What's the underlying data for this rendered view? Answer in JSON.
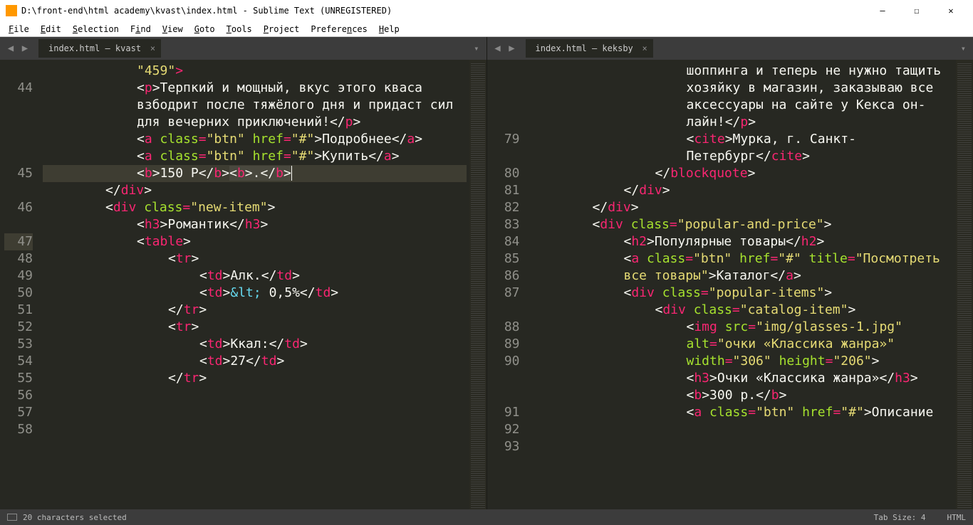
{
  "titlebar": {
    "path": "D:\\front-end\\html academy\\kvast\\index.html - Sublime Text (UNREGISTERED)"
  },
  "menu": [
    "File",
    "Edit",
    "Selection",
    "Find",
    "View",
    "Goto",
    "Tools",
    "Project",
    "Preferences",
    "Help"
  ],
  "tabs": {
    "left": "index.html — kvast",
    "right": "index.html — keksby"
  },
  "left": {
    "gutter": [
      "",
      "44",
      "",
      "",
      "",
      "",
      "45",
      "",
      "46",
      "",
      "47",
      "48",
      "49",
      "50",
      "51",
      "52",
      "53",
      "54",
      "55",
      "56",
      "57",
      "58",
      ""
    ],
    "lines": [
      {
        "indent": 3,
        "tokens": [
          {
            "c": "s",
            "t": "\"459\""
          },
          {
            "c": "t",
            "t": ">"
          }
        ]
      },
      {
        "indent": 3,
        "tokens": [
          {
            "c": "p",
            "t": "<"
          },
          {
            "c": "t",
            "t": "p"
          },
          {
            "c": "p",
            "t": ">"
          },
          {
            "c": "w",
            "t": "Терпкий и мощный, вкус этого кваса взбодрит после тяжёлого дня и придаст сил для вечерних приключений!"
          },
          {
            "c": "p",
            "t": "</"
          },
          {
            "c": "t",
            "t": "p"
          },
          {
            "c": "p",
            "t": ">"
          }
        ]
      },
      {
        "indent": 3,
        "tokens": [
          {
            "c": "p",
            "t": "<"
          },
          {
            "c": "t",
            "t": "a"
          },
          {
            "c": "w",
            "t": " "
          },
          {
            "c": "a",
            "t": "class"
          },
          {
            "c": "t",
            "t": "="
          },
          {
            "c": "s",
            "t": "\"btn\""
          },
          {
            "c": "w",
            "t": " "
          },
          {
            "c": "a",
            "t": "href"
          },
          {
            "c": "t",
            "t": "="
          },
          {
            "c": "s",
            "t": "\"#\""
          },
          {
            "c": "p",
            "t": ">"
          },
          {
            "c": "w",
            "t": "Подробнее"
          },
          {
            "c": "p",
            "t": "</"
          },
          {
            "c": "t",
            "t": "a"
          },
          {
            "c": "p",
            "t": ">"
          }
        ]
      },
      {
        "indent": 3,
        "tokens": [
          {
            "c": "p",
            "t": "<"
          },
          {
            "c": "t",
            "t": "a"
          },
          {
            "c": "w",
            "t": " "
          },
          {
            "c": "a",
            "t": "class"
          },
          {
            "c": "t",
            "t": "="
          },
          {
            "c": "s",
            "t": "\"btn\""
          },
          {
            "c": "w",
            "t": " "
          },
          {
            "c": "a",
            "t": "href"
          },
          {
            "c": "t",
            "t": "="
          },
          {
            "c": "s",
            "t": "\"#\""
          },
          {
            "c": "p",
            "t": ">"
          },
          {
            "c": "w",
            "t": "Купить"
          },
          {
            "c": "p",
            "t": "</"
          },
          {
            "c": "t",
            "t": "a"
          },
          {
            "c": "p",
            "t": ">"
          }
        ]
      },
      {
        "indent": 3,
        "sel": true,
        "tokens": [
          {
            "c": "p",
            "t": "<"
          },
          {
            "c": "t",
            "t": "b"
          },
          {
            "c": "p",
            "t": ">"
          },
          {
            "c": "w",
            "t": "150 Р"
          },
          {
            "c": "p",
            "t": "</"
          },
          {
            "c": "t",
            "t": "b"
          },
          {
            "c": "p",
            "t": ">"
          },
          {
            "c": "p",
            "t": "<"
          },
          {
            "c": "t",
            "t": "b"
          },
          {
            "c": "p",
            "t": ">"
          },
          {
            "c": "w",
            "t": "."
          },
          {
            "c": "p",
            "t": "</"
          },
          {
            "c": "t",
            "t": "b"
          },
          {
            "c": "p",
            "t": ">"
          }
        ]
      },
      {
        "indent": 2,
        "tokens": [
          {
            "c": "p",
            "t": "</"
          },
          {
            "c": "t",
            "t": "div"
          },
          {
            "c": "p",
            "t": ">"
          }
        ]
      },
      {
        "indent": 2,
        "tokens": [
          {
            "c": "p",
            "t": "<"
          },
          {
            "c": "t",
            "t": "div"
          },
          {
            "c": "w",
            "t": " "
          },
          {
            "c": "a",
            "t": "class"
          },
          {
            "c": "t",
            "t": "="
          },
          {
            "c": "s",
            "t": "\"new-item\""
          },
          {
            "c": "p",
            "t": ">"
          }
        ]
      },
      {
        "indent": 3,
        "tokens": [
          {
            "c": "p",
            "t": "<"
          },
          {
            "c": "t",
            "t": "h3"
          },
          {
            "c": "p",
            "t": ">"
          },
          {
            "c": "w",
            "t": "Романтик"
          },
          {
            "c": "p",
            "t": "</"
          },
          {
            "c": "t",
            "t": "h3"
          },
          {
            "c": "p",
            "t": ">"
          }
        ]
      },
      {
        "indent": 3,
        "tokens": [
          {
            "c": "p",
            "t": "<"
          },
          {
            "c": "t",
            "t": "table"
          },
          {
            "c": "p",
            "t": ">"
          }
        ]
      },
      {
        "indent": 4,
        "tokens": [
          {
            "c": "p",
            "t": "<"
          },
          {
            "c": "t",
            "t": "tr"
          },
          {
            "c": "p",
            "t": ">"
          }
        ]
      },
      {
        "indent": 5,
        "tokens": [
          {
            "c": "p",
            "t": "<"
          },
          {
            "c": "t",
            "t": "td"
          },
          {
            "c": "p",
            "t": ">"
          },
          {
            "c": "w",
            "t": "Алк."
          },
          {
            "c": "p",
            "t": "</"
          },
          {
            "c": "t",
            "t": "td"
          },
          {
            "c": "p",
            "t": ">"
          }
        ]
      },
      {
        "indent": 5,
        "tokens": [
          {
            "c": "p",
            "t": "<"
          },
          {
            "c": "t",
            "t": "td"
          },
          {
            "c": "p",
            "t": ">"
          },
          {
            "c": "c",
            "t": "&lt;"
          },
          {
            "c": "w",
            "t": " 0,5%"
          },
          {
            "c": "p",
            "t": "</"
          },
          {
            "c": "t",
            "t": "td"
          },
          {
            "c": "p",
            "t": ">"
          }
        ]
      },
      {
        "indent": 4,
        "tokens": [
          {
            "c": "p",
            "t": "</"
          },
          {
            "c": "t",
            "t": "tr"
          },
          {
            "c": "p",
            "t": ">"
          }
        ]
      },
      {
        "indent": 4,
        "tokens": [
          {
            "c": "p",
            "t": "<"
          },
          {
            "c": "t",
            "t": "tr"
          },
          {
            "c": "p",
            "t": ">"
          }
        ]
      },
      {
        "indent": 5,
        "tokens": [
          {
            "c": "p",
            "t": "<"
          },
          {
            "c": "t",
            "t": "td"
          },
          {
            "c": "p",
            "t": ">"
          },
          {
            "c": "w",
            "t": "Ккал:"
          },
          {
            "c": "p",
            "t": "</"
          },
          {
            "c": "t",
            "t": "td"
          },
          {
            "c": "p",
            "t": ">"
          }
        ]
      },
      {
        "indent": 5,
        "tokens": [
          {
            "c": "p",
            "t": "<"
          },
          {
            "c": "t",
            "t": "td"
          },
          {
            "c": "p",
            "t": ">"
          },
          {
            "c": "w",
            "t": "27"
          },
          {
            "c": "p",
            "t": "</"
          },
          {
            "c": "t",
            "t": "td"
          },
          {
            "c": "p",
            "t": ">"
          }
        ]
      },
      {
        "indent": 4,
        "tokens": [
          {
            "c": "p",
            "t": "</"
          },
          {
            "c": "t",
            "t": "tr"
          },
          {
            "c": "p",
            "t": ">"
          }
        ]
      }
    ]
  },
  "right": {
    "gutter": [
      "",
      "",
      "",
      "",
      "79",
      "",
      "80",
      "81",
      "82",
      "83",
      "84",
      "85",
      "86",
      "87",
      "",
      "88",
      "89",
      "90",
      "",
      "",
      "91",
      "92",
      "93"
    ],
    "lines": [
      {
        "indent": 5,
        "tokens": [
          {
            "c": "w",
            "t": "шоппинга и теперь не нужно тащить хозяйку в магазин, заказываю все аксессуары на сайте у Кекса он-лайн!"
          },
          {
            "c": "p",
            "t": "</"
          },
          {
            "c": "t",
            "t": "p"
          },
          {
            "c": "p",
            "t": ">"
          }
        ]
      },
      {
        "indent": 5,
        "tokens": [
          {
            "c": "p",
            "t": "<"
          },
          {
            "c": "t",
            "t": "cite"
          },
          {
            "c": "p",
            "t": ">"
          },
          {
            "c": "w",
            "t": "Мурка, г. Санкт-Петербург"
          },
          {
            "c": "p",
            "t": "</"
          },
          {
            "c": "t",
            "t": "cite"
          },
          {
            "c": "p",
            "t": ">"
          }
        ]
      },
      {
        "indent": 4,
        "tokens": [
          {
            "c": "p",
            "t": "</"
          },
          {
            "c": "t",
            "t": "blockquote"
          },
          {
            "c": "p",
            "t": ">"
          }
        ]
      },
      {
        "indent": 3,
        "tokens": [
          {
            "c": "p",
            "t": "</"
          },
          {
            "c": "t",
            "t": "div"
          },
          {
            "c": "p",
            "t": ">"
          }
        ]
      },
      {
        "indent": 2,
        "tokens": [
          {
            "c": "p",
            "t": "</"
          },
          {
            "c": "t",
            "t": "div"
          },
          {
            "c": "p",
            "t": ">"
          }
        ]
      },
      {
        "indent": 0,
        "tokens": []
      },
      {
        "indent": 0,
        "tokens": []
      },
      {
        "indent": 2,
        "tokens": [
          {
            "c": "p",
            "t": "<"
          },
          {
            "c": "t",
            "t": "div"
          },
          {
            "c": "w",
            "t": " "
          },
          {
            "c": "a",
            "t": "class"
          },
          {
            "c": "t",
            "t": "="
          },
          {
            "c": "s",
            "t": "\"popular-and-price\""
          },
          {
            "c": "p",
            "t": ">"
          }
        ]
      },
      {
        "indent": 3,
        "tokens": [
          {
            "c": "p",
            "t": "<"
          },
          {
            "c": "t",
            "t": "h2"
          },
          {
            "c": "p",
            "t": ">"
          },
          {
            "c": "w",
            "t": "Популярные товары"
          },
          {
            "c": "p",
            "t": "</"
          },
          {
            "c": "t",
            "t": "h2"
          },
          {
            "c": "p",
            "t": ">"
          }
        ]
      },
      {
        "indent": 3,
        "tokens": [
          {
            "c": "p",
            "t": "<"
          },
          {
            "c": "t",
            "t": "a"
          },
          {
            "c": "w",
            "t": " "
          },
          {
            "c": "a",
            "t": "class"
          },
          {
            "c": "t",
            "t": "="
          },
          {
            "c": "s",
            "t": "\"btn\""
          },
          {
            "c": "w",
            "t": " "
          },
          {
            "c": "a",
            "t": "href"
          },
          {
            "c": "t",
            "t": "="
          },
          {
            "c": "s",
            "t": "\"#\""
          },
          {
            "c": "w",
            "t": " "
          },
          {
            "c": "a",
            "t": "title"
          },
          {
            "c": "t",
            "t": "="
          },
          {
            "c": "s",
            "t": "\"Посмотреть все товары\""
          },
          {
            "c": "p",
            "t": ">"
          },
          {
            "c": "w",
            "t": "Каталог"
          },
          {
            "c": "p",
            "t": "</"
          },
          {
            "c": "t",
            "t": "a"
          },
          {
            "c": "p",
            "t": ">"
          }
        ]
      },
      {
        "indent": 3,
        "tokens": [
          {
            "c": "p",
            "t": "<"
          },
          {
            "c": "t",
            "t": "div"
          },
          {
            "c": "w",
            "t": " "
          },
          {
            "c": "a",
            "t": "class"
          },
          {
            "c": "t",
            "t": "="
          },
          {
            "c": "s",
            "t": "\"popular-items\""
          },
          {
            "c": "p",
            "t": ">"
          }
        ]
      },
      {
        "indent": 4,
        "tokens": [
          {
            "c": "p",
            "t": "<"
          },
          {
            "c": "t",
            "t": "div"
          },
          {
            "c": "w",
            "t": " "
          },
          {
            "c": "a",
            "t": "class"
          },
          {
            "c": "t",
            "t": "="
          },
          {
            "c": "s",
            "t": "\"catalog-item\""
          },
          {
            "c": "p",
            "t": ">"
          }
        ]
      },
      {
        "indent": 5,
        "tokens": [
          {
            "c": "p",
            "t": "<"
          },
          {
            "c": "t",
            "t": "img"
          },
          {
            "c": "w",
            "t": " "
          },
          {
            "c": "a",
            "t": "src"
          },
          {
            "c": "t",
            "t": "="
          },
          {
            "c": "s",
            "t": "\"img/glasses-1.jpg\""
          },
          {
            "c": "w",
            "t": " "
          },
          {
            "c": "a",
            "t": "alt"
          },
          {
            "c": "t",
            "t": "="
          },
          {
            "c": "s",
            "t": "\"очки «Классика жанра»\""
          },
          {
            "c": "w",
            "t": " "
          },
          {
            "c": "a",
            "t": "width"
          },
          {
            "c": "t",
            "t": "="
          },
          {
            "c": "s",
            "t": "\"306\""
          },
          {
            "c": "w",
            "t": " "
          },
          {
            "c": "a",
            "t": "height"
          },
          {
            "c": "t",
            "t": "="
          },
          {
            "c": "s",
            "t": "\"206\""
          },
          {
            "c": "p",
            "t": ">"
          }
        ]
      },
      {
        "indent": 5,
        "tokens": [
          {
            "c": "p",
            "t": "<"
          },
          {
            "c": "t",
            "t": "h3"
          },
          {
            "c": "p",
            "t": ">"
          },
          {
            "c": "w",
            "t": "Очки «Классика жанра»"
          },
          {
            "c": "p",
            "t": "</"
          },
          {
            "c": "t",
            "t": "h3"
          },
          {
            "c": "p",
            "t": ">"
          }
        ]
      },
      {
        "indent": 5,
        "tokens": [
          {
            "c": "p",
            "t": "<"
          },
          {
            "c": "t",
            "t": "b"
          },
          {
            "c": "p",
            "t": ">"
          },
          {
            "c": "w",
            "t": "300 р."
          },
          {
            "c": "p",
            "t": "</"
          },
          {
            "c": "t",
            "t": "b"
          },
          {
            "c": "p",
            "t": ">"
          }
        ]
      },
      {
        "indent": 5,
        "tokens": [
          {
            "c": "p",
            "t": "<"
          },
          {
            "c": "t",
            "t": "a"
          },
          {
            "c": "w",
            "t": " "
          },
          {
            "c": "a",
            "t": "class"
          },
          {
            "c": "t",
            "t": "="
          },
          {
            "c": "s",
            "t": "\"btn\""
          },
          {
            "c": "w",
            "t": " "
          },
          {
            "c": "a",
            "t": "href"
          },
          {
            "c": "t",
            "t": "="
          },
          {
            "c": "s",
            "t": "\"#\""
          },
          {
            "c": "p",
            "t": ">"
          },
          {
            "c": "w",
            "t": "Описание"
          }
        ]
      }
    ]
  },
  "statusbar": {
    "selection": "20 characters selected",
    "tabsize": "Tab Size: 4",
    "syntax": "HTML"
  }
}
